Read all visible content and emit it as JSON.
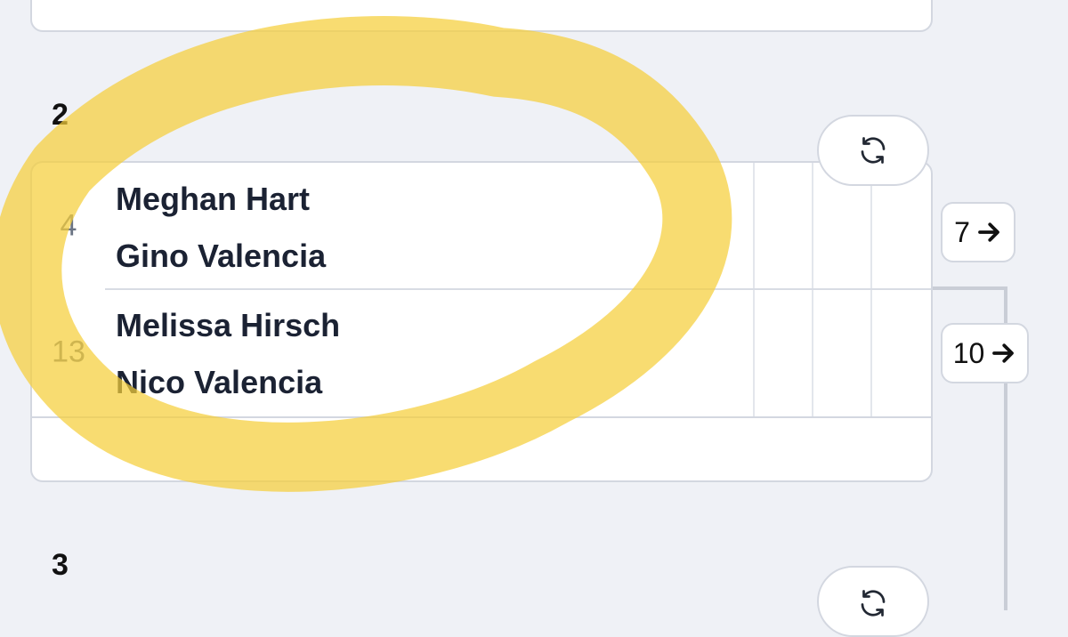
{
  "colors": {
    "background": "#eff1f6",
    "card": "#ffffff",
    "border": "#d3d7e0",
    "highlight": "#f5cf3a"
  },
  "round2": {
    "label": "2",
    "refresh_icon": "refresh-icon",
    "teams": [
      {
        "seed": "4",
        "players": [
          "Meghan Hart",
          "Gino Valencia"
        ],
        "next_match": "7"
      },
      {
        "seed": "13",
        "players": [
          "Melissa Hirsch",
          "Nico Valencia"
        ],
        "next_match": "10"
      }
    ]
  },
  "round3": {
    "label": "3",
    "refresh_icon": "refresh-icon"
  },
  "next_icon": "arrow-right-icon"
}
